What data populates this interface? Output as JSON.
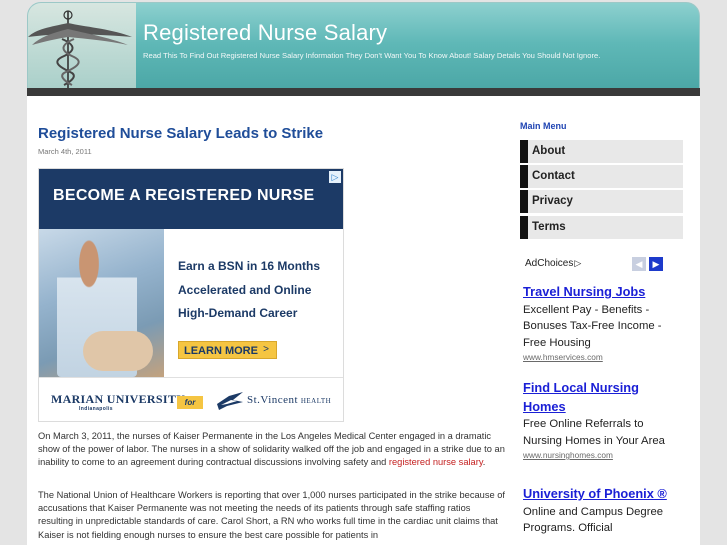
{
  "header": {
    "title": "Registered Nurse Salary",
    "tagline": "Read This To Find Out Registered Nurse Salary Information They Don't Want You To Know About! Salary Details You Should Not Ignore."
  },
  "post": {
    "title": "Registered Nurse Salary Leads to Strike",
    "date": "March 4th, 2011",
    "paragraph1_text": "On March 3, 2011, the nurses of Kaiser Permanente in the Los Angeles Medical Center engaged in a dramatic show of the power of labor. The nurses in a show of solidarity walked off the job and engaged in a strike due to an inability to come to an agreement during contractual discussions involving safety and ",
    "paragraph1_link": "registered nurse salary",
    "paragraph1_end": ".",
    "paragraph2_text": "The National Union of Healthcare Workers is reporting that over 1,000 nurses participated in the strike because of accusations that Kaiser Permanente was not meeting the needs of its patients through safe staffing ratios resulting in unpredictable standards of care. Carol Short, a RN who works full time in the cardiac unit claims that Kaiser is not fielding enough nurses to ensure the best care possible for patients in"
  },
  "banner_ad": {
    "headline": "BECOME A REGISTERED NURSE",
    "line1": "Earn a BSN in 16 Months",
    "line2": "Accelerated and Online",
    "line3": "High-Demand Career",
    "cta": "LEARN MORE",
    "cta_arrow": ">",
    "school": "MARIAN UNIVERSITY",
    "school_sub": "Indianapolis",
    "for_label": "for",
    "partner": "St.Vincent",
    "partner_sub": "HEALTH",
    "info_glyph": "▷"
  },
  "sidebar": {
    "menu_heading": "Main Menu",
    "menu_items": [
      "About",
      "Contact",
      "Privacy",
      "Terms"
    ],
    "adchoices_label": "AdChoices",
    "adchoices_glyph": "▷",
    "prev_glyph": "◀",
    "next_glyph": "▶",
    "text_ads": [
      {
        "title": "Travel Nursing Jobs",
        "description": "Excellent Pay - Benefits - Bonuses Tax-Free Income - Free Housing",
        "url": "www.hmservices.com"
      },
      {
        "title": "Find Local Nursing Homes",
        "description": "Free Online Referrals to Nursing Homes in Your Area",
        "url": "www.nursinghomes.com"
      },
      {
        "title": "University of Phoenix ®",
        "description": "Online and Campus Degree Programs. Official",
        "url": ""
      }
    ]
  },
  "colors": {
    "header_teal": "#5fb8b7",
    "post_title": "#1f4d99",
    "link_red": "#c42020",
    "ad_link_blue": "#1a1fd6",
    "menu_heading_blue": "#1f44b3"
  }
}
